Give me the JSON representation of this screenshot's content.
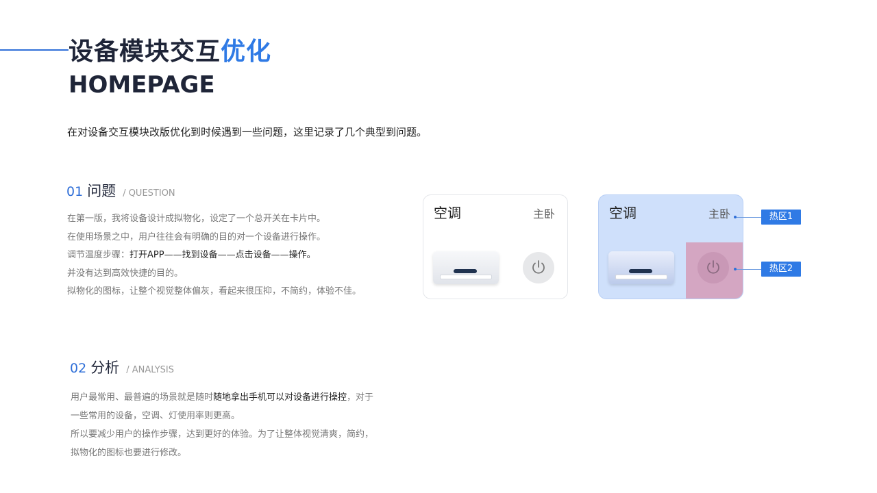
{
  "header": {
    "title_main": "设备模块交互",
    "title_highlight": "优化",
    "subtitle": "HOMEPAGE",
    "intro": "在对设备交互模块改版优化到时候遇到一些问题，这里记录了几个典型到问题。"
  },
  "question": {
    "num": "01",
    "name": "问题",
    "tag": "/ QUESTION",
    "lines": [
      "在第一版，我将设备设计成拟物化，设定了一个总开关在卡片中。",
      "在使用场景之中，用户往往会有明确的目的对一个设备进行操作。"
    ],
    "steps_label": "调节温度步骤：",
    "steps_text": "打开APP——找到设备——点击设备——操作。",
    "lines2": [
      "并没有达到高效快捷的目的。",
      "拟物化的图标，让整个视觉整体偏灰，看起来很压抑，不简约，体验不佳。"
    ]
  },
  "analysis": {
    "num": "02",
    "name": "分析",
    "tag": "/ ANALYSIS",
    "line1_pre": "用户最常用、最普遍的场景就是随时",
    "line1_bold": "随地拿出手机可以对设备进行操控",
    "line1_post": "，对于",
    "line2": "一些常用的设备，空调、灯使用率则更高。",
    "line3": "所以要减少用户的操作步骤，达到更好的体验。为了让整体视觉清爽，简约，",
    "line4": "拟物化的图标也要进行修改。"
  },
  "cards": [
    {
      "title": "空调",
      "room": "主卧"
    },
    {
      "title": "空调",
      "room": "主卧"
    }
  ],
  "hotzones": [
    "热区1",
    "热区2"
  ],
  "colors": {
    "accent": "#2f7ae5",
    "hotzone1": "#cfe0fb",
    "hotzone2": "#d4a6c2"
  },
  "icons": [
    "power-icon",
    "air-conditioner-icon"
  ]
}
